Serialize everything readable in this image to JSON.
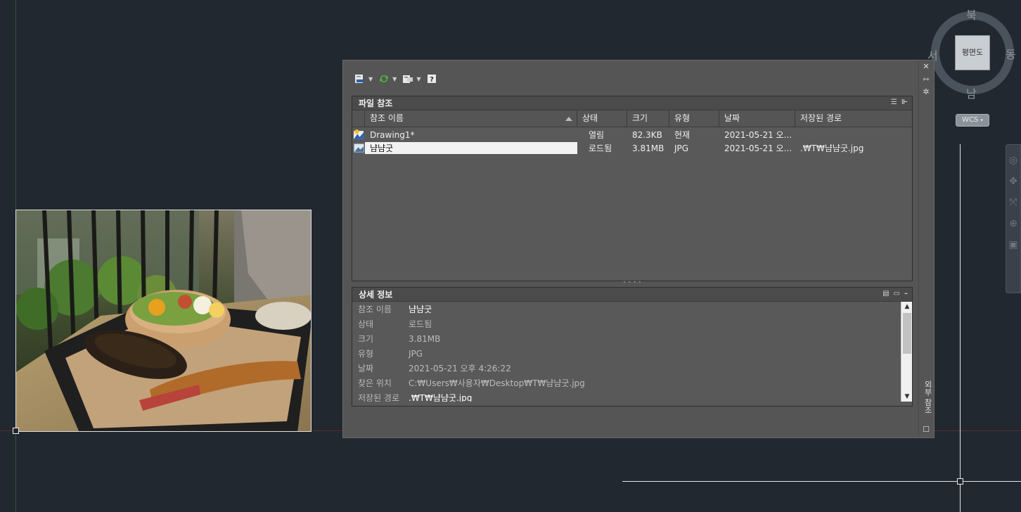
{
  "viewcube": {
    "north": "북",
    "south": "남",
    "east": "동",
    "west": "서",
    "face": "평면도",
    "wcs": "WCS"
  },
  "palette": {
    "side_title": "외부 참조",
    "file_refs": {
      "title": "파일 참조",
      "columns": [
        "참조 이름",
        "상태",
        "크기",
        "유형",
        "날짜",
        "저장된 경로"
      ],
      "rows": [
        {
          "name": "Drawing1*",
          "status": "열림",
          "size": "82.3KB",
          "type": "현재",
          "date": "2021-05-21 오...",
          "path": ""
        },
        {
          "name": "냠냠굿",
          "status": "로드됨",
          "size": "3.81MB",
          "type": "JPG",
          "date": "2021-05-21 오...",
          "path": ".₩T₩냠냠굿.jpg"
        }
      ]
    },
    "details": {
      "title": "상세 정보",
      "rows": [
        {
          "label": "참조 이름",
          "value": "냠냠굿"
        },
        {
          "label": "상태",
          "value": "로드됨"
        },
        {
          "label": "크기",
          "value": "3.81MB"
        },
        {
          "label": "유형",
          "value": "JPG"
        },
        {
          "label": "날짜",
          "value": "2021-05-21 오후 4:26:22"
        },
        {
          "label": "찾은 위치",
          "value": "C:₩Users₩사용자₩Desktop₩T₩냠냠굿.jpg"
        },
        {
          "label": "저장된 경로",
          "value": ".₩T₩냠냠굿.jpg"
        }
      ]
    }
  }
}
